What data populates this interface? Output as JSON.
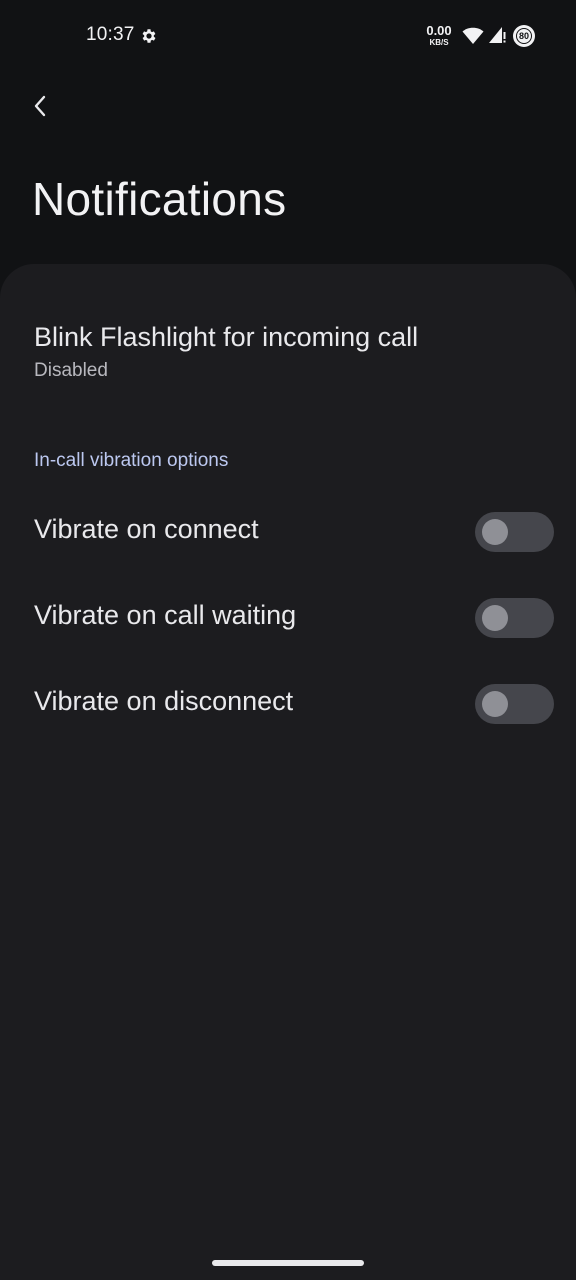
{
  "status_bar": {
    "time": "10:37",
    "net_speed_value": "0.00",
    "net_speed_unit": "KB/S",
    "battery_level": "80",
    "icons": [
      "gear-icon",
      "wifi-icon",
      "signal-icon",
      "battery-icon"
    ]
  },
  "app_bar": {
    "back_icon": "chevron-left-icon",
    "title": "Notifications"
  },
  "preferences": {
    "flashlight": {
      "title": "Blink Flashlight for incoming call",
      "summary": "Disabled"
    },
    "section_header": "In-call vibration options",
    "switches": [
      {
        "label": "Vibrate on connect",
        "checked": false
      },
      {
        "label": "Vibrate on call waiting",
        "checked": false
      },
      {
        "label": "Vibrate on disconnect",
        "checked": false
      }
    ]
  },
  "colors": {
    "background": "#111214",
    "card": "#1c1c1f",
    "section_header": "#bcc8f0",
    "toggle_track_off": "#45464c",
    "toggle_thumb_off": "#8f9096"
  }
}
